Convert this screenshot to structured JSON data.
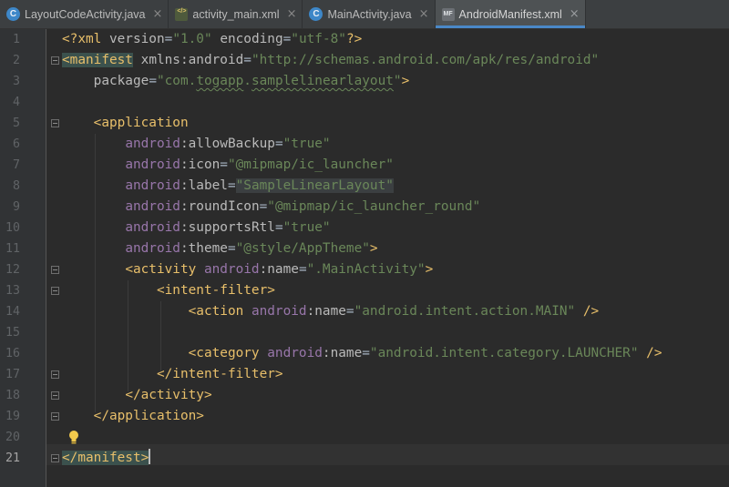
{
  "tabs": [
    {
      "label": "LayoutCodeActivity.java",
      "icon": "java-class-icon",
      "glyph": "C",
      "active": false
    },
    {
      "label": "activity_main.xml",
      "icon": "xml-file-icon",
      "glyph": "</>",
      "active": false
    },
    {
      "label": "MainActivity.java",
      "icon": "java-class-icon",
      "glyph": "C",
      "active": false
    },
    {
      "label": "AndroidManifest.xml",
      "icon": "manifest-file-icon",
      "glyph": "MF",
      "active": true
    }
  ],
  "tab_close_glyph": "×",
  "editor": {
    "current_line": 21,
    "line_numbers": [
      "1",
      "2",
      "3",
      "4",
      "5",
      "6",
      "7",
      "8",
      "9",
      "10",
      "11",
      "12",
      "13",
      "14",
      "15",
      "16",
      "17",
      "18",
      "19",
      "20",
      "21"
    ],
    "lines": [
      [
        {
          "t": "plain",
          "v": ""
        },
        {
          "t": "tag",
          "v": "<?xml "
        },
        {
          "t": "attr",
          "v": "version"
        },
        {
          "t": "plain",
          "v": "="
        },
        {
          "t": "val",
          "v": "\"1.0\""
        },
        {
          "t": "plain",
          "v": " "
        },
        {
          "t": "attr",
          "v": "encoding"
        },
        {
          "t": "plain",
          "v": "="
        },
        {
          "t": "val",
          "v": "\"utf-8\""
        },
        {
          "t": "tag",
          "v": "?>"
        }
      ],
      [
        {
          "t": "tag hl",
          "v": "<manifest"
        },
        {
          "t": "plain",
          "v": " "
        },
        {
          "t": "attr",
          "v": "xmlns:android"
        },
        {
          "t": "plain",
          "v": "="
        },
        {
          "t": "val",
          "v": "\"http://schemas.android.com/apk/res/android\""
        }
      ],
      [
        {
          "t": "plain",
          "v": "    "
        },
        {
          "t": "attr",
          "v": "package"
        },
        {
          "t": "plain",
          "v": "="
        },
        {
          "t": "val",
          "v": "\"com."
        },
        {
          "t": "val squig",
          "v": "togapp"
        },
        {
          "t": "val",
          "v": "."
        },
        {
          "t": "val squig",
          "v": "samplelinearlayout"
        },
        {
          "t": "val",
          "v": "\""
        },
        {
          "t": "tag",
          "v": ">"
        }
      ],
      [],
      [
        {
          "t": "plain",
          "v": "    "
        },
        {
          "t": "tag",
          "v": "<application"
        }
      ],
      [
        {
          "t": "plain",
          "v": "        "
        },
        {
          "t": "ns",
          "v": "android"
        },
        {
          "t": "attr",
          "v": ":allowBackup"
        },
        {
          "t": "plain",
          "v": "="
        },
        {
          "t": "val",
          "v": "\"true\""
        }
      ],
      [
        {
          "t": "plain",
          "v": "        "
        },
        {
          "t": "ns",
          "v": "android"
        },
        {
          "t": "attr",
          "v": ":icon"
        },
        {
          "t": "plain",
          "v": "="
        },
        {
          "t": "val",
          "v": "\"@mipmap/ic_launcher\""
        }
      ],
      [
        {
          "t": "plain",
          "v": "        "
        },
        {
          "t": "ns",
          "v": "android"
        },
        {
          "t": "attr",
          "v": ":label"
        },
        {
          "t": "plain",
          "v": "="
        },
        {
          "t": "val hl2",
          "v": "\"SampleLinearLayout\""
        }
      ],
      [
        {
          "t": "plain",
          "v": "        "
        },
        {
          "t": "ns",
          "v": "android"
        },
        {
          "t": "attr",
          "v": ":roundIcon"
        },
        {
          "t": "plain",
          "v": "="
        },
        {
          "t": "val",
          "v": "\"@mipmap/ic_launcher_round\""
        }
      ],
      [
        {
          "t": "plain",
          "v": "        "
        },
        {
          "t": "ns",
          "v": "android"
        },
        {
          "t": "attr",
          "v": ":supportsRtl"
        },
        {
          "t": "plain",
          "v": "="
        },
        {
          "t": "val",
          "v": "\"true\""
        }
      ],
      [
        {
          "t": "plain",
          "v": "        "
        },
        {
          "t": "ns",
          "v": "android"
        },
        {
          "t": "attr",
          "v": ":theme"
        },
        {
          "t": "plain",
          "v": "="
        },
        {
          "t": "val",
          "v": "\"@style/AppTheme\""
        },
        {
          "t": "tag",
          "v": ">"
        }
      ],
      [
        {
          "t": "plain",
          "v": "        "
        },
        {
          "t": "tag",
          "v": "<activity "
        },
        {
          "t": "ns",
          "v": "android"
        },
        {
          "t": "attr",
          "v": ":name"
        },
        {
          "t": "plain",
          "v": "="
        },
        {
          "t": "val",
          "v": "\".MainActivity\""
        },
        {
          "t": "tag",
          "v": ">"
        }
      ],
      [
        {
          "t": "plain",
          "v": "            "
        },
        {
          "t": "tag",
          "v": "<intent-filter>"
        }
      ],
      [
        {
          "t": "plain",
          "v": "                "
        },
        {
          "t": "tag",
          "v": "<action "
        },
        {
          "t": "ns",
          "v": "android"
        },
        {
          "t": "attr",
          "v": ":name"
        },
        {
          "t": "plain",
          "v": "="
        },
        {
          "t": "val",
          "v": "\"android.intent.action.MAIN\""
        },
        {
          "t": "tag",
          "v": " />"
        }
      ],
      [],
      [
        {
          "t": "plain",
          "v": "                "
        },
        {
          "t": "tag",
          "v": "<category "
        },
        {
          "t": "ns",
          "v": "android"
        },
        {
          "t": "attr",
          "v": ":name"
        },
        {
          "t": "plain",
          "v": "="
        },
        {
          "t": "val",
          "v": "\"android.intent.category.LAUNCHER\""
        },
        {
          "t": "tag",
          "v": " />"
        }
      ],
      [
        {
          "t": "plain",
          "v": "            "
        },
        {
          "t": "tag",
          "v": "</intent-filter>"
        }
      ],
      [
        {
          "t": "plain",
          "v": "        "
        },
        {
          "t": "tag",
          "v": "</activity>"
        }
      ],
      [
        {
          "t": "plain",
          "v": "    "
        },
        {
          "t": "tag",
          "v": "</application>"
        }
      ],
      [],
      [
        {
          "t": "tag hl",
          "v": "</manifest"
        },
        {
          "t": "tag hl",
          "v": ">"
        }
      ]
    ],
    "fold_lines": [
      2,
      5,
      12,
      13,
      17,
      18,
      19,
      21
    ]
  }
}
